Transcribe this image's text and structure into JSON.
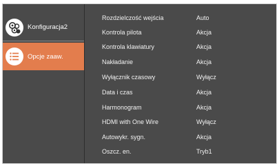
{
  "sidebar": {
    "items": [
      {
        "label": "Konfiguracja2",
        "icon": "gear-cluster-icon"
      },
      {
        "label": "Opcje zaaw.",
        "icon": "list-icon",
        "selected": true
      }
    ]
  },
  "menu": {
    "rows": [
      {
        "label": "Rozdzielczość wejścia",
        "value": "Auto"
      },
      {
        "label": "Kontrola pilota",
        "value": "Akcja"
      },
      {
        "label": "Kontrola klawiatury",
        "value": "Akcja"
      },
      {
        "label": "Nakładanie",
        "value": "Akcja"
      },
      {
        "label": "Wyłącznik czasowy",
        "value": "Wyłącz"
      },
      {
        "label": "Data i czas",
        "value": "Akcja"
      },
      {
        "label": "Harmonogram",
        "value": "Akcja"
      },
      {
        "label": "HDMI with One Wire",
        "value": "Wyłącz"
      },
      {
        "label": "Autowykr. sygn.",
        "value": "Akcja"
      },
      {
        "label": "Oszcz. en.",
        "value": "Tryb1"
      }
    ]
  },
  "colors": {
    "accent": "#e37d4d",
    "panel": "#4a4a4a",
    "text": "#f2f2f2"
  }
}
